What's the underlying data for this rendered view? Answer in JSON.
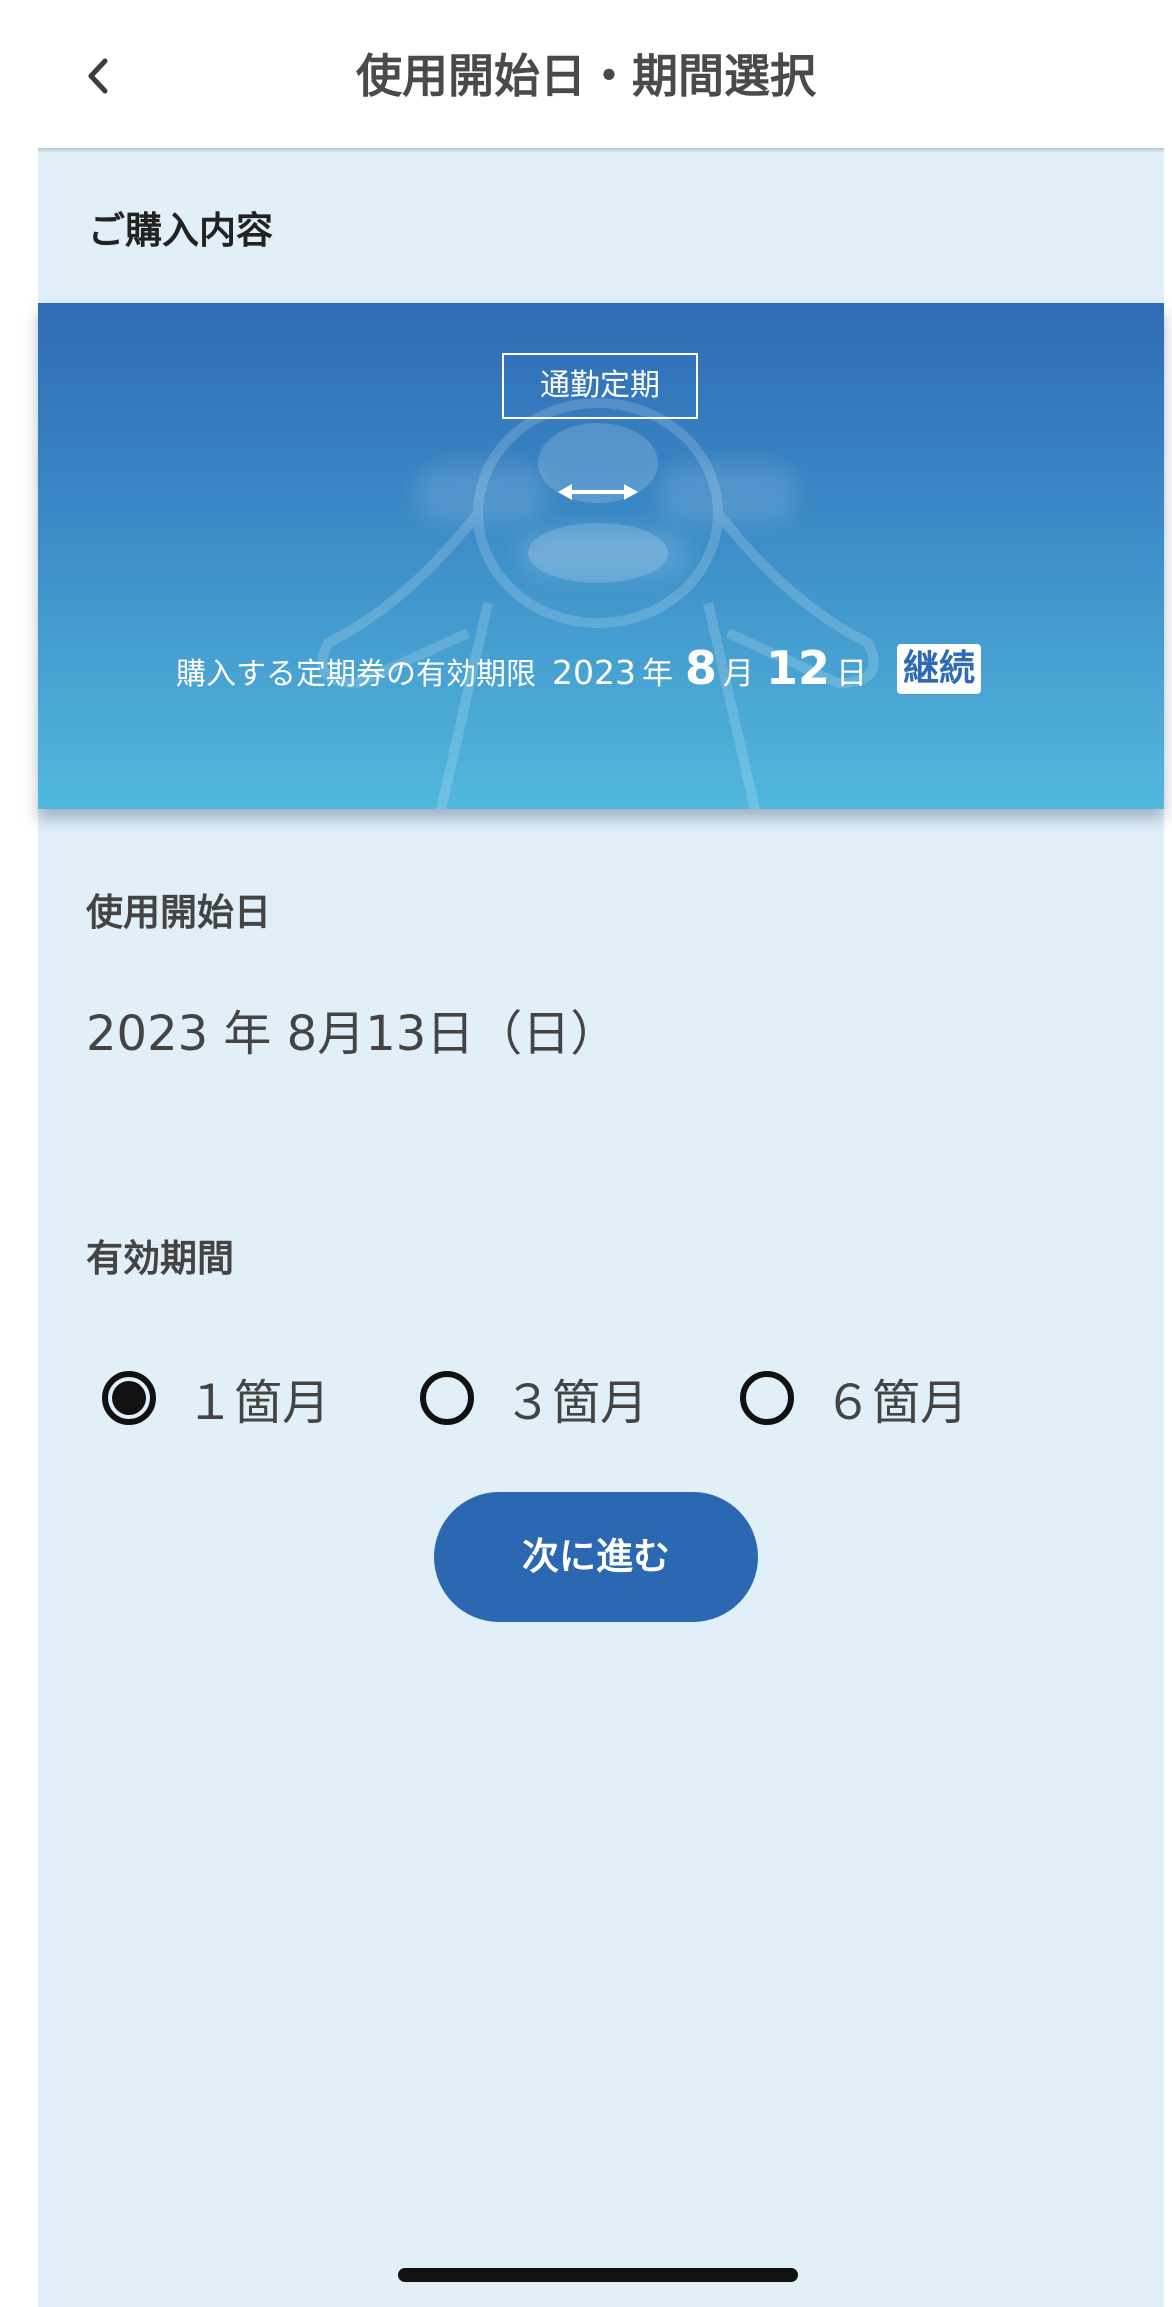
{
  "header": {
    "title": "使用開始日・期間選択",
    "back_icon": "chevron-left-icon"
  },
  "purchase": {
    "section_label": "ご購入内容",
    "ticket": {
      "type_label": "通勤定期",
      "route_arrow_icon": "double-arrow-icon",
      "expiry_label": "購入する定期券の有効期限",
      "expiry_year": "2023",
      "year_unit": "年",
      "expiry_month": "8",
      "month_unit": "月",
      "expiry_day": "12",
      "day_unit": "日",
      "renew_badge": "継続"
    }
  },
  "start_date": {
    "label": "使用開始日",
    "value": "2023 年 8月13日（日）"
  },
  "period": {
    "label": "有効期間",
    "options": [
      {
        "label": "１箇月",
        "selected": true
      },
      {
        "label": "３箇月",
        "selected": false
      },
      {
        "label": "６箇月",
        "selected": false
      }
    ]
  },
  "actions": {
    "next_label": "次に進む"
  },
  "colors": {
    "accent": "#2c67b2",
    "background": "#e1eff9",
    "card_gradient_top": "#2f6bb4",
    "card_gradient_bottom": "#52b8dc"
  }
}
